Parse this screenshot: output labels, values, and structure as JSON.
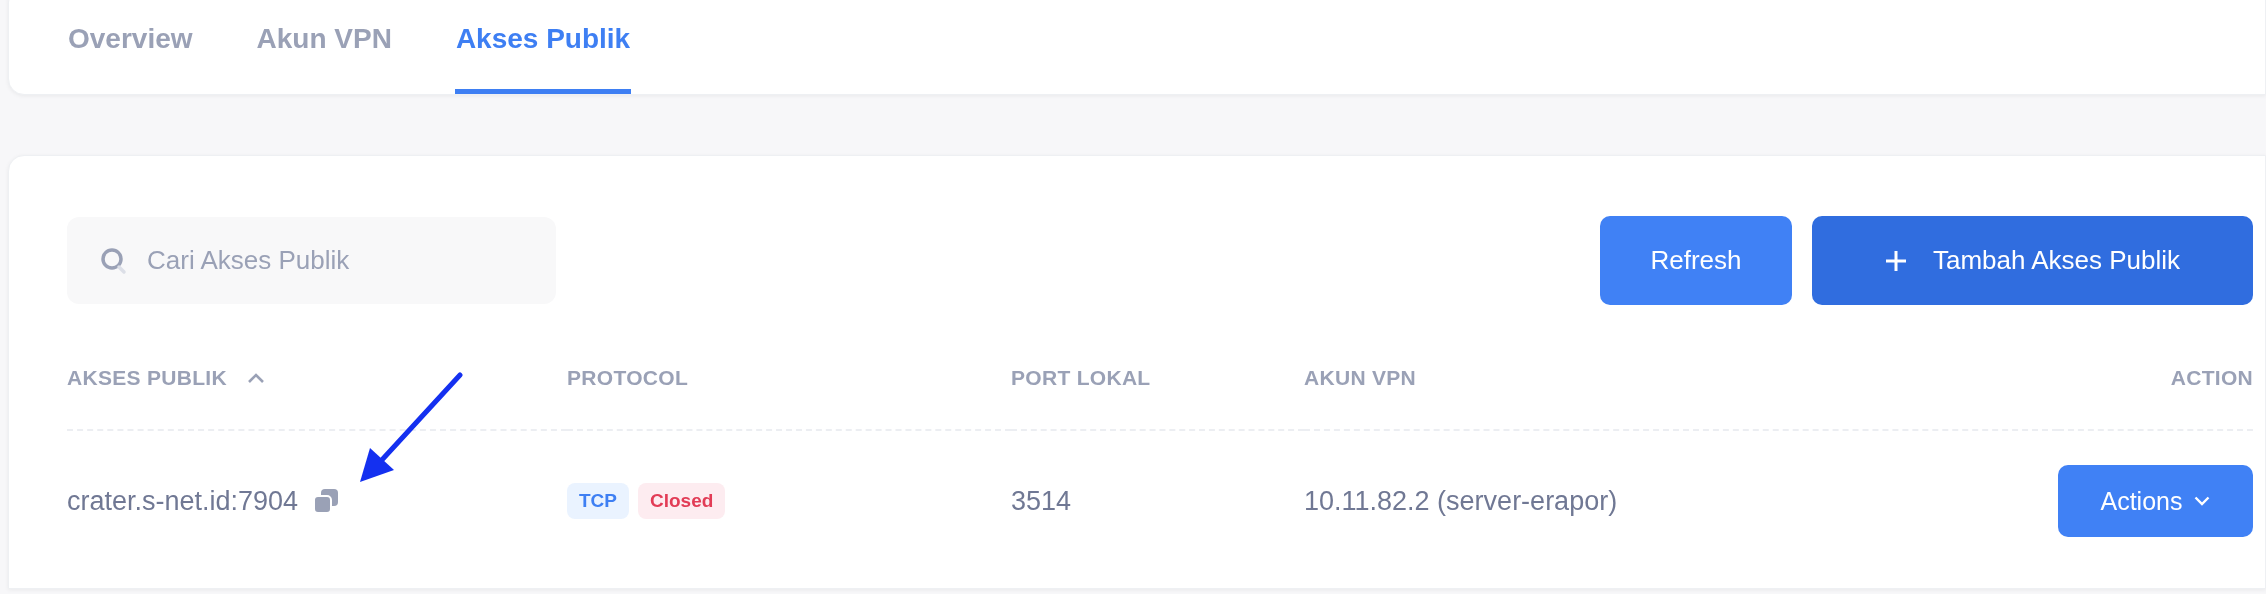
{
  "tabs": [
    {
      "label": "Overview",
      "selected": false
    },
    {
      "label": "Akun VPN",
      "selected": false
    },
    {
      "label": "Akses Publik",
      "selected": true
    }
  ],
  "search": {
    "placeholder": "Cari Akses Publik"
  },
  "buttons": [
    {
      "label": "Refresh",
      "kind": "plain"
    },
    {
      "label": "Tambah Akses Publik",
      "kind": "add"
    }
  ],
  "table": {
    "columns": [
      {
        "label": "AKSES PUBLIK",
        "sorted": true
      },
      {
        "label": "PROTOCOL"
      },
      {
        "label": "PORT LOKAL"
      },
      {
        "label": "AKUN VPN"
      },
      {
        "label": "ACTION"
      }
    ],
    "rows": [
      {
        "akses_publik": "crater.s-net.id:7904",
        "badges": [
          {
            "label": "TCP",
            "kind": "protocol"
          },
          {
            "label": "Closed",
            "kind": "closed"
          }
        ],
        "port_lokal": "3514",
        "akun_vpn": "10.11.82.2 (server-erapor)",
        "action": "Actions"
      }
    ]
  }
}
